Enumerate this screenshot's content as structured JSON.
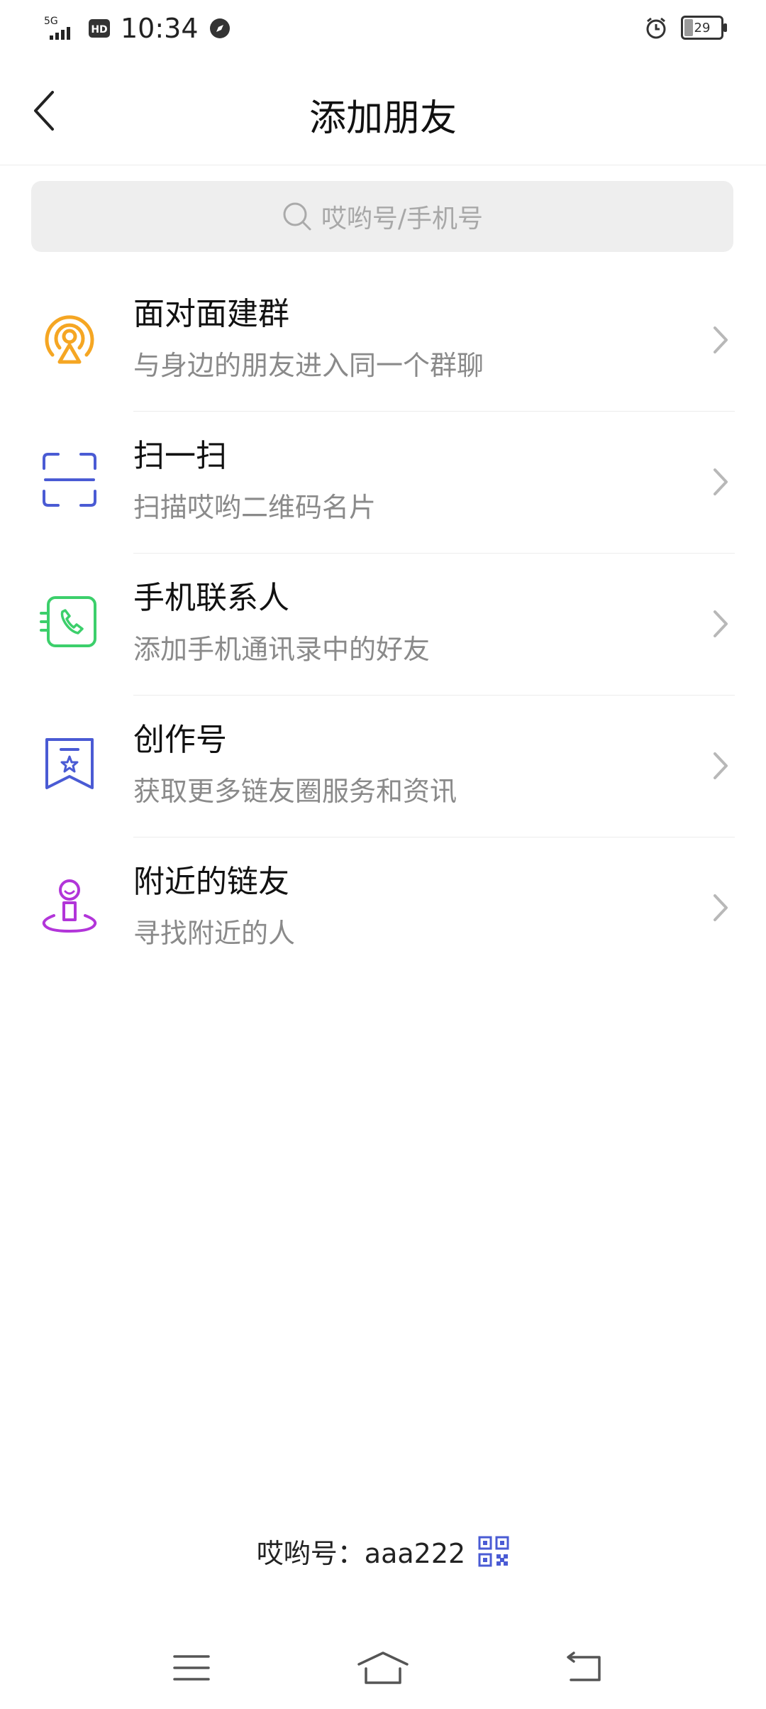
{
  "status_bar": {
    "network": "5G",
    "hd": "HD",
    "time": "10:34",
    "battery": "29"
  },
  "header": {
    "title": "添加朋友"
  },
  "search": {
    "placeholder": "哎哟号/手机号"
  },
  "items": [
    {
      "title": "面对面建群",
      "desc": "与身边的朋友进入同一个群聊",
      "icon": "radar-location-icon",
      "color": "#f5a623"
    },
    {
      "title": "扫一扫",
      "desc": "扫描哎哟二维码名片",
      "icon": "scan-icon",
      "color": "#4a5bd4"
    },
    {
      "title": "手机联系人",
      "desc": "添加手机通讯录中的好友",
      "icon": "phone-contact-icon",
      "color": "#3ccf6b"
    },
    {
      "title": "创作号",
      "desc": "获取更多链友圈服务和资讯",
      "icon": "creator-badge-icon",
      "color": "#4a5bd4"
    },
    {
      "title": "附近的链友",
      "desc": "寻找附近的人",
      "icon": "nearby-people-icon",
      "color": "#b235d9"
    }
  ],
  "footer": {
    "id_label": "哎哟号：aaa222"
  },
  "colors": {
    "accent_blue": "#4a5bd4"
  }
}
